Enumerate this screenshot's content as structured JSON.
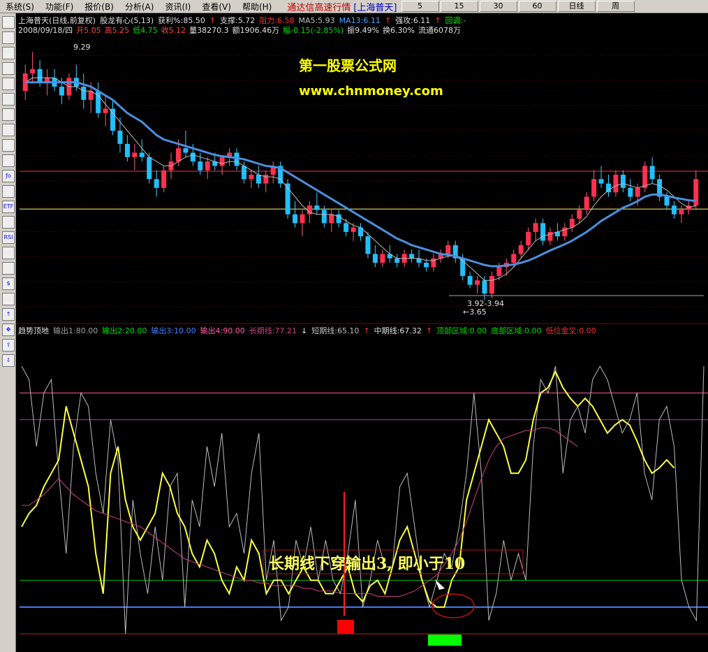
{
  "menubar": {
    "items": [
      "系统(S)",
      "功能(F)",
      "报价(B)",
      "分析(A)",
      "资讯(I)",
      "查看(V)",
      "帮助(H)"
    ],
    "title": "通达信高速行情",
    "stock": "[上海普天]",
    "periods": [
      "5",
      "15",
      "30",
      "60",
      "日线",
      "周"
    ]
  },
  "toolbar": {
    "icons": [
      "grid-icon",
      "window-icon",
      "line-chart-icon",
      "bar-chart-icon",
      "tile-icon",
      "table-icon",
      "book-icon",
      "f10-icon",
      "mail-icon",
      "people-icon",
      "fo-icon",
      "search-icon",
      "etf-icon",
      "wave-icon",
      "rsi-icon",
      "refresh-icon",
      "layout-icon",
      "dollar-icon",
      "tool-icon",
      "up-arrow-icon",
      "move-icon",
      "up-green-icon",
      "down-green-icon"
    ],
    "labels": [
      "",
      "",
      "",
      "",
      "",
      "",
      "",
      "",
      "",
      "",
      "ƒo",
      "",
      "ETF",
      "",
      "RSI",
      "",
      "",
      "$",
      "",
      "↑",
      "✥",
      "⇧",
      "⇩"
    ]
  },
  "main_panel": {
    "header_line1": [
      {
        "text": "上海普天(日线,前复权)",
        "color": "#e0e0e0"
      },
      {
        "text": "股龙有心(5,13)",
        "color": "#e0e0e0"
      },
      {
        "text": "获利%:85.50",
        "color": "#e0e0e0"
      },
      {
        "text": "↑",
        "color": "#ff3030"
      },
      {
        "text": "支撑:5.72",
        "color": "#e0e0e0"
      },
      {
        "text": "阻力:6.58",
        "color": "#ff3030"
      },
      {
        "text": "MA5:5.93",
        "color": "#c0c0c0"
      },
      {
        "text": "MA13:6.11",
        "color": "#4aa8ff"
      },
      {
        "text": "↑",
        "color": "#ff3030"
      },
      {
        "text": "强攻:6.11",
        "color": "#e0e0e0"
      },
      {
        "text": "↑",
        "color": "#ff3030"
      },
      {
        "text": "回调:-",
        "color": "#00ff00"
      }
    ],
    "header_line2": [
      {
        "text": "2008/09/18/四",
        "color": "#e0e0e0"
      },
      {
        "text": "开5.05",
        "color": "#ff4040"
      },
      {
        "text": "高5.25",
        "color": "#ff4040"
      },
      {
        "text": "低4.75",
        "color": "#00e000"
      },
      {
        "text": "收5.12",
        "color": "#ff4040"
      },
      {
        "text": "量38270.3",
        "color": "#e0e0e0"
      },
      {
        "text": "额1906.46万",
        "color": "#e0e0e0"
      },
      {
        "text": "幅-0.15(-2.85%)",
        "color": "#00e000"
      },
      {
        "text": "振9.49%",
        "color": "#e0e0e0"
      },
      {
        "text": "换6.30%",
        "color": "#e0e0e0"
      },
      {
        "text": "流通6078万",
        "color": "#e0e0e0"
      }
    ],
    "watermark_title": "第一股票公式网",
    "watermark_url": "www.chnmoney.com",
    "high_label": "9.29",
    "range_label": "3.92-3.94",
    "low_label": "3.65"
  },
  "indicator_panel": {
    "header": [
      {
        "text": "趋势顶地",
        "color": "#e0e0e0"
      },
      {
        "text": "输出1:80.00",
        "color": "#a0a0a0"
      },
      {
        "text": "输出2:20.00",
        "color": "#00e000"
      },
      {
        "text": "输出3:10.00",
        "color": "#4a80ff"
      },
      {
        "text": "输出4:90.00",
        "color": "#ff60a0"
      },
      {
        "text": "长期线:77.21",
        "color": "#d04080"
      },
      {
        "text": "↓",
        "color": "#e0e0e0"
      },
      {
        "text": "短期线:65.10",
        "color": "#c0c0c0"
      },
      {
        "text": "↑",
        "color": "#ff3030"
      },
      {
        "text": "中期线:67.32",
        "color": "#e0e0e0"
      },
      {
        "text": "↑",
        "color": "#ff3030"
      },
      {
        "text": "顶部区域:0.00",
        "color": "#00e000"
      },
      {
        "text": "底部区域:0.00",
        "color": "#00e000"
      },
      {
        "text": "低位金叉:0.00",
        "color": "#ff3030"
      }
    ],
    "annotation": "长期线下穿输出3, 即小于10"
  },
  "chart_data": [
    {
      "type": "candlestick",
      "title": "上海普天(日线,前复权)",
      "ylim": [
        3.5,
        9.5
      ],
      "h_levels": [
        {
          "value": 6.58,
          "color": "#ff3030"
        },
        {
          "value": 5.72,
          "color": "#ffff80"
        }
      ],
      "candles": [
        [
          8.4,
          9.0,
          8.2,
          8.8
        ],
        [
          8.8,
          9.29,
          8.6,
          8.9
        ],
        [
          8.9,
          9.1,
          8.5,
          8.6
        ],
        [
          8.6,
          8.9,
          8.3,
          8.7
        ],
        [
          8.7,
          8.9,
          8.4,
          8.5
        ],
        [
          8.5,
          8.7,
          8.1,
          8.3
        ],
        [
          8.3,
          8.8,
          8.2,
          8.7
        ],
        [
          8.7,
          9.0,
          8.4,
          8.5
        ],
        [
          8.5,
          8.8,
          8.0,
          8.2
        ],
        [
          8.2,
          8.6,
          7.9,
          8.4
        ],
        [
          8.4,
          8.6,
          7.8,
          7.9
        ],
        [
          7.9,
          8.3,
          7.6,
          8.0
        ],
        [
          8.0,
          8.2,
          7.4,
          7.5
        ],
        [
          7.5,
          7.8,
          7.0,
          7.2
        ],
        [
          7.2,
          7.4,
          6.8,
          6.9
        ],
        [
          6.9,
          7.2,
          6.6,
          7.0
        ],
        [
          7.0,
          7.3,
          6.8,
          6.9
        ],
        [
          6.9,
          7.0,
          6.3,
          6.4
        ],
        [
          6.4,
          6.6,
          6.0,
          6.2
        ],
        [
          6.2,
          6.7,
          6.1,
          6.6
        ],
        [
          6.6,
          7.0,
          6.4,
          6.8
        ],
        [
          6.8,
          7.3,
          6.7,
          7.1
        ],
        [
          7.1,
          7.5,
          6.9,
          7.0
        ],
        [
          7.0,
          7.2,
          6.7,
          6.8
        ],
        [
          6.8,
          7.0,
          6.5,
          6.6
        ],
        [
          6.6,
          6.9,
          6.4,
          6.8
        ],
        [
          6.8,
          7.0,
          6.6,
          6.7
        ],
        [
          6.7,
          6.9,
          6.5,
          6.9
        ],
        [
          6.9,
          7.1,
          6.7,
          7.0
        ],
        [
          7.0,
          7.1,
          6.6,
          6.7
        ],
        [
          6.7,
          6.8,
          6.3,
          6.4
        ],
        [
          6.4,
          6.6,
          6.2,
          6.5
        ],
        [
          6.5,
          6.7,
          6.2,
          6.3
        ],
        [
          6.3,
          6.6,
          6.1,
          6.5
        ],
        [
          6.5,
          6.8,
          6.3,
          6.7
        ],
        [
          6.7,
          6.8,
          6.2,
          6.3
        ],
        [
          6.3,
          6.4,
          5.5,
          5.6
        ],
        [
          5.6,
          5.9,
          5.3,
          5.4
        ],
        [
          5.4,
          5.7,
          5.1,
          5.6
        ],
        [
          5.6,
          5.9,
          5.4,
          5.8
        ],
        [
          5.8,
          6.1,
          5.6,
          5.7
        ],
        [
          5.7,
          5.8,
          5.3,
          5.4
        ],
        [
          5.4,
          5.7,
          5.2,
          5.6
        ],
        [
          5.6,
          5.7,
          5.3,
          5.4
        ],
        [
          5.4,
          5.5,
          5.1,
          5.2
        ],
        [
          5.2,
          5.4,
          5.0,
          5.3
        ],
        [
          5.3,
          5.4,
          5.0,
          5.1
        ],
        [
          5.1,
          5.2,
          4.6,
          4.7
        ],
        [
          4.7,
          4.9,
          4.4,
          4.5
        ],
        [
          4.5,
          4.8,
          4.4,
          4.7
        ],
        [
          4.7,
          4.9,
          4.5,
          4.6
        ],
        [
          4.6,
          4.7,
          4.4,
          4.5
        ],
        [
          4.5,
          4.8,
          4.4,
          4.7
        ],
        [
          4.7,
          4.8,
          4.5,
          4.6
        ],
        [
          4.6,
          4.8,
          4.4,
          4.5
        ],
        [
          4.5,
          4.6,
          4.3,
          4.4
        ],
        [
          4.4,
          4.7,
          4.3,
          4.6
        ],
        [
          4.6,
          4.8,
          4.5,
          4.7
        ],
        [
          4.7,
          5.0,
          4.6,
          4.9
        ],
        [
          4.9,
          5.0,
          4.5,
          4.6
        ],
        [
          4.6,
          4.7,
          4.1,
          4.2
        ],
        [
          4.2,
          4.3,
          3.92,
          4.0
        ],
        [
          4.0,
          4.2,
          3.8,
          4.1
        ],
        [
          4.1,
          4.2,
          3.65,
          3.8
        ],
        [
          3.8,
          4.3,
          3.7,
          4.2
        ],
        [
          4.2,
          4.5,
          4.1,
          4.4
        ],
        [
          4.4,
          4.6,
          4.2,
          4.5
        ],
        [
          4.5,
          4.8,
          4.4,
          4.7
        ],
        [
          4.7,
          5.0,
          4.6,
          4.9
        ],
        [
          4.9,
          5.3,
          4.8,
          5.2
        ],
        [
          5.2,
          5.5,
          5.0,
          5.4
        ],
        [
          5.4,
          5.5,
          4.9,
          5.0
        ],
        [
          5.0,
          5.3,
          4.9,
          5.2
        ],
        [
          5.2,
          5.4,
          5.0,
          5.1
        ],
        [
          5.1,
          5.4,
          5.0,
          5.3
        ],
        [
          5.3,
          5.6,
          5.2,
          5.5
        ],
        [
          5.5,
          5.8,
          5.4,
          5.7
        ],
        [
          5.7,
          6.1,
          5.6,
          6.0
        ],
        [
          6.0,
          6.6,
          5.9,
          6.4
        ],
        [
          6.4,
          6.7,
          6.2,
          6.3
        ],
        [
          6.3,
          6.5,
          6.0,
          6.1
        ],
        [
          6.1,
          6.6,
          6.0,
          6.5
        ],
        [
          6.5,
          6.6,
          6.1,
          6.2
        ],
        [
          6.2,
          6.4,
          5.9,
          6.0
        ],
        [
          6.0,
          6.3,
          5.8,
          6.2
        ],
        [
          6.2,
          6.8,
          6.1,
          6.7
        ],
        [
          6.7,
          6.9,
          6.3,
          6.4
        ],
        [
          6.4,
          6.5,
          5.9,
          6.0
        ],
        [
          6.0,
          6.1,
          5.7,
          5.8
        ],
        [
          5.8,
          5.9,
          5.5,
          5.6
        ],
        [
          5.6,
          5.8,
          5.4,
          5.7
        ],
        [
          5.7,
          5.9,
          5.6,
          5.8
        ],
        [
          5.8,
          6.6,
          5.7,
          6.4
        ]
      ],
      "ma13": [
        8.6,
        8.6,
        8.6,
        8.6,
        8.6,
        8.6,
        8.6,
        8.6,
        8.55,
        8.5,
        8.4,
        8.3,
        8.2,
        8.05,
        7.9,
        7.8,
        7.7,
        7.55,
        7.4,
        7.3,
        7.25,
        7.2,
        7.15,
        7.1,
        7.05,
        7.0,
        6.95,
        6.92,
        6.9,
        6.88,
        6.85,
        6.8,
        6.75,
        6.7,
        6.68,
        6.65,
        6.55,
        6.45,
        6.35,
        6.25,
        6.15,
        6.05,
        5.95,
        5.85,
        5.75,
        5.65,
        5.55,
        5.45,
        5.35,
        5.25,
        5.15,
        5.05,
        4.98,
        4.9,
        4.85,
        4.8,
        4.75,
        4.7,
        4.68,
        4.65,
        4.6,
        4.55,
        4.5,
        4.45,
        4.42,
        4.42,
        4.44,
        4.46,
        4.5,
        4.55,
        4.62,
        4.7,
        4.78,
        4.85,
        4.92,
        5.0,
        5.1,
        5.2,
        5.32,
        5.45,
        5.55,
        5.65,
        5.75,
        5.82,
        5.9,
        6.0,
        6.05,
        6.05,
        6.02,
        5.98,
        5.95,
        5.92,
        5.9
      ],
      "ma5": [
        8.6,
        8.7,
        8.7,
        8.7,
        8.7,
        8.6,
        8.5,
        8.5,
        8.4,
        8.4,
        8.3,
        8.1,
        7.9,
        7.7,
        7.5,
        7.3,
        7.1,
        6.9,
        6.8,
        6.7,
        6.7,
        6.8,
        6.9,
        6.95,
        6.9,
        6.85,
        6.8,
        6.75,
        6.8,
        6.8,
        6.7,
        6.6,
        6.5,
        6.45,
        6.45,
        6.4,
        6.2,
        6.0,
        5.8,
        5.65,
        5.6,
        5.6,
        5.6,
        5.55,
        5.45,
        5.35,
        5.3,
        5.15,
        5.0,
        4.85,
        4.7,
        4.6,
        4.6,
        4.6,
        4.6,
        4.55,
        4.55,
        4.6,
        4.65,
        4.65,
        4.55,
        4.4,
        4.25,
        4.1,
        4.1,
        4.15,
        4.25,
        4.4,
        4.6,
        4.8,
        5.0,
        5.1,
        5.15,
        5.2,
        5.25,
        5.3,
        5.4,
        5.55,
        5.8,
        6.0,
        6.15,
        6.25,
        6.3,
        6.25,
        6.2,
        6.25,
        6.3,
        6.25,
        6.15,
        6.0,
        5.85,
        5.75,
        5.8
      ]
    },
    {
      "type": "line",
      "title": "趋势顶地",
      "ylim": [
        0,
        100
      ],
      "h_levels": [
        {
          "name": "输出1",
          "value": 80,
          "color": "#a040a0"
        },
        {
          "name": "输出2",
          "value": 20,
          "color": "#00c000"
        },
        {
          "name": "输出3",
          "value": 10,
          "color": "#4a80ff"
        },
        {
          "name": "输出4",
          "value": 90,
          "color": "#ff60a0"
        }
      ],
      "series": [
        {
          "name": "短期线",
          "color": "#bdbdbd",
          "values": [
            100,
            95,
            70,
            90,
            95,
            60,
            30,
            70,
            90,
            85,
            60,
            45,
            80,
            65,
            0,
            50,
            30,
            15,
            40,
            20,
            55,
            60,
            10,
            50,
            40,
            70,
            55,
            75,
            40,
            45,
            30,
            60,
            75,
            20,
            35,
            5,
            10,
            35,
            25,
            40,
            20,
            35,
            20,
            15,
            30,
            50,
            10,
            20,
            35,
            25,
            25,
            55,
            60,
            40,
            20,
            10,
            20,
            30,
            25,
            40,
            60,
            90,
            60,
            5,
            15,
            35,
            20,
            30,
            20,
            70,
            95,
            90,
            100,
            60,
            80,
            85,
            75,
            95,
            100,
            95,
            85,
            75,
            80,
            90,
            60,
            50,
            80,
            85,
            70,
            20,
            10,
            5,
            100
          ]
        },
        {
          "name": "中期线",
          "color": "#ffff40",
          "values": [
            40,
            45,
            48,
            55,
            60,
            65,
            85,
            75,
            65,
            55,
            30,
            15,
            60,
            70,
            50,
            40,
            35,
            40,
            45,
            60,
            55,
            45,
            40,
            30,
            25,
            35,
            30,
            20,
            15,
            25,
            20,
            35,
            30,
            15,
            20,
            20,
            15,
            20,
            25,
            20,
            20,
            15,
            15,
            20,
            25,
            15,
            12,
            18,
            20,
            15,
            25,
            35,
            40,
            30,
            20,
            12,
            10,
            10,
            20,
            25,
            50,
            60,
            70,
            80,
            75,
            70,
            60,
            60,
            65,
            80,
            90,
            92,
            98,
            92,
            88,
            85,
            88,
            85,
            80,
            75,
            78,
            80,
            78,
            72,
            65,
            60,
            62,
            65,
            62
          ]
        },
        {
          "name": "长期线",
          "color": "#d04080",
          "values": [
            48,
            48,
            50,
            52,
            55,
            58,
            55,
            52,
            50,
            48,
            46,
            45,
            44,
            43,
            42,
            41,
            40,
            38,
            36,
            34,
            32,
            30,
            28,
            27,
            26,
            25,
            24,
            23,
            22,
            21,
            20,
            20,
            19,
            19,
            18,
            18,
            18,
            18,
            17,
            17,
            16,
            16,
            16,
            15,
            15,
            15,
            15,
            15,
            14,
            14,
            14,
            14,
            15,
            16,
            18,
            20,
            22,
            26,
            30,
            35,
            42,
            50,
            58,
            65,
            70,
            73,
            74,
            75,
            76,
            76,
            77,
            77,
            76,
            74,
            72,
            70
          ]
        }
      ]
    }
  ]
}
